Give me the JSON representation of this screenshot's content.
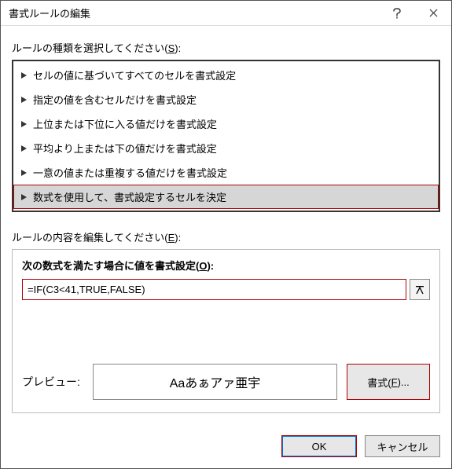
{
  "title": "書式ルールの編集",
  "ruleTypeLabel_pre": "ルールの種類を選択してください(",
  "ruleTypeLabel_u": "S",
  "ruleTypeLabel_post": "):",
  "ruleTypes": [
    "セルの値に基づいてすべてのセルを書式設定",
    "指定の値を含むセルだけを書式設定",
    "上位または下位に入る値だけを書式設定",
    "平均より上または下の値だけを書式設定",
    "一意の値または重複する値だけを書式設定",
    "数式を使用して、書式設定するセルを決定"
  ],
  "selectedRuleTypeIndex": 5,
  "editLabel_pre": "ルールの内容を編集してください(",
  "editLabel_u": "E",
  "editLabel_post": "):",
  "formulaHeader_pre": "次の数式を満たす場合に値を書式設定(",
  "formulaHeader_u": "O",
  "formulaHeader_post": "):",
  "formulaValue": "=IF(C3<41,TRUE,FALSE)",
  "previewLabel": "プレビュー:",
  "previewText": "Aaあぁアァ亜宇",
  "formatButton_pre": "書式(",
  "formatButton_u": "F",
  "formatButton_post": ")...",
  "okLabel": "OK",
  "cancelLabel": "キャンセル"
}
